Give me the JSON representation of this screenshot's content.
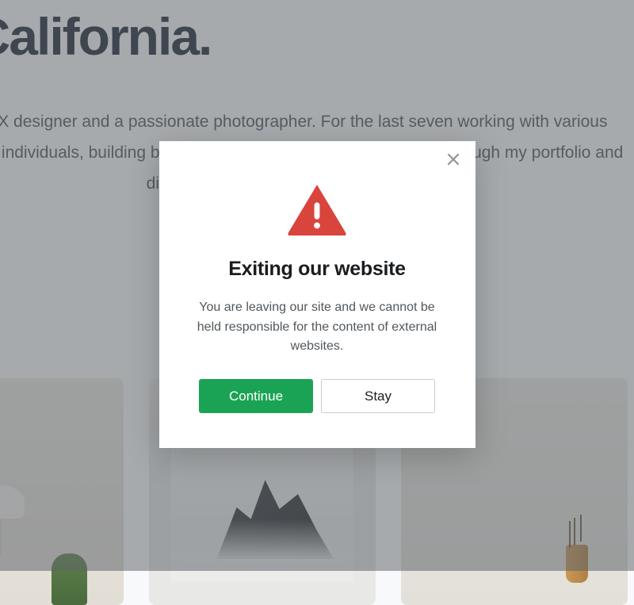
{
  "hero": {
    "heading_fragment": "d in California.",
    "paragraph": "ebsite UI & UX designer and a passionate photographer. For the last seven working with various companies and individuals, building beautiful mockups als. Feel free to look through my portfolio and discover a bit more about me"
  },
  "modal": {
    "title": "Exiting our website",
    "body": "You are leaving our site and we cannot be held responsible for the content of external websites.",
    "primary_button": "Continue",
    "secondary_button": "Stay"
  },
  "colors": {
    "danger": "#d9453c",
    "primary": "#1ba355",
    "text_dark": "#1a2332",
    "text_body": "#51575c"
  }
}
